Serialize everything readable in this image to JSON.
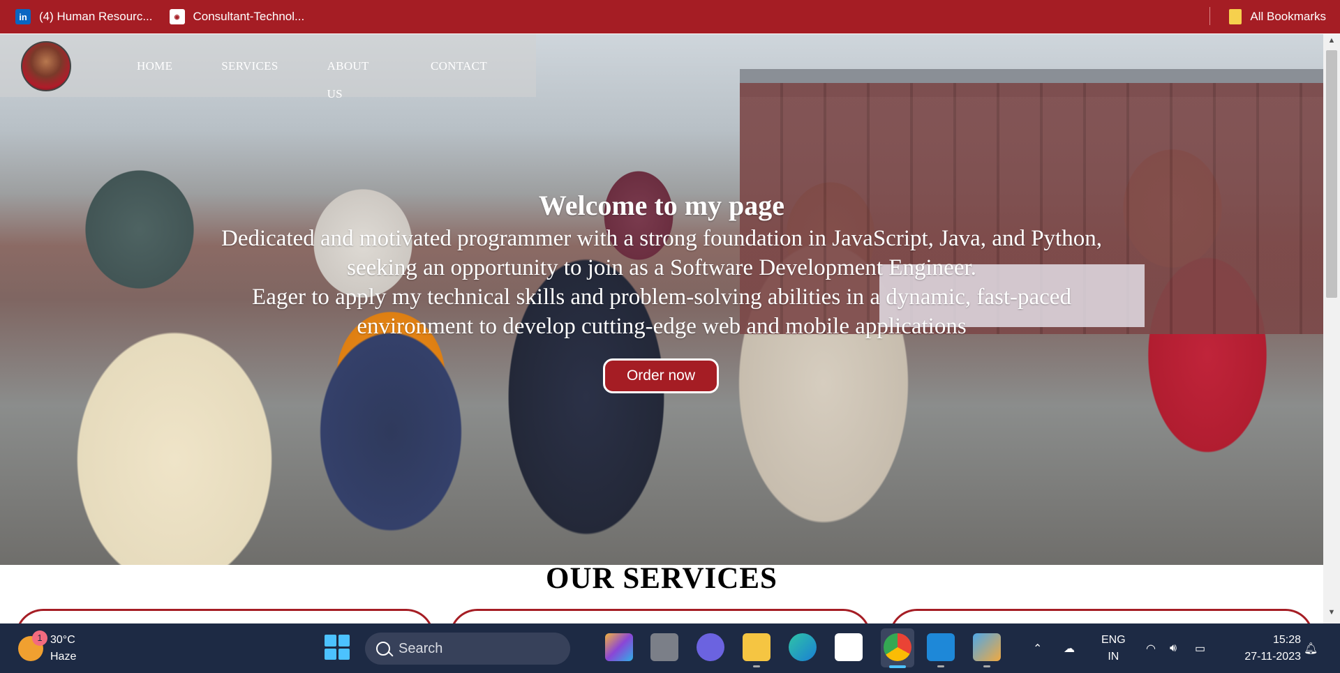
{
  "bookmarks": {
    "items": [
      {
        "label": "(4) Human Resourc...",
        "icon": "linkedin-icon"
      },
      {
        "label": "Consultant-Technol...",
        "icon": "consultant-icon"
      }
    ],
    "all_bookmarks_label": "All Bookmarks"
  },
  "nav": {
    "items": [
      "HOME",
      "SERVICES",
      "ABOUT US",
      "CONTACT"
    ]
  },
  "hero": {
    "title": "Welcome to my page",
    "line1": "Dedicated and motivated programmer with a strong foundation in JavaScript, Java, and Python, seeking an opportunity to join as a Software Development Engineer.",
    "line2": "Eager to apply my technical skills and problem-solving abilities in a dynamic, fast-paced environment to develop cutting-edge web and mobile applications",
    "button": "Order now"
  },
  "services": {
    "title": "OUR SERVICES"
  },
  "taskbar": {
    "weather_temp": "30°C",
    "weather_desc": "Haze",
    "badge": "1",
    "search_label": "Search",
    "lang_top": "ENG",
    "lang_bottom": "IN",
    "time": "15:28",
    "date": "27-11-2023"
  },
  "colors": {
    "accent": "#a51d24",
    "taskbar": "#1d2a44"
  }
}
